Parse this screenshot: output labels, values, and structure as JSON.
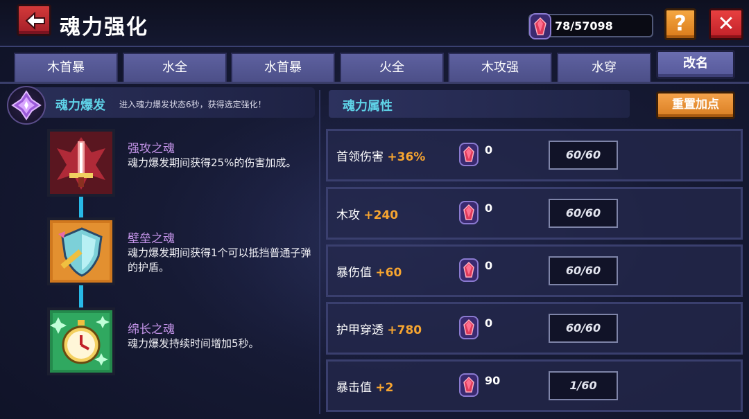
{
  "header": {
    "title": "魂力强化",
    "soul_currency": "78/57098",
    "help_label": "?",
    "close_label": "✕"
  },
  "tabs": [
    {
      "label": "木首暴"
    },
    {
      "label": "水全"
    },
    {
      "label": "水首暴"
    },
    {
      "label": "火全"
    },
    {
      "label": "木攻强"
    },
    {
      "label": "水穿"
    }
  ],
  "rename_label": "改名",
  "burst": {
    "title": "魂力爆发",
    "desc": "进入魂力爆发状态6秒，获得选定强化！"
  },
  "souls": [
    {
      "title": "强攻之魂",
      "desc": "魂力爆发期间获得25%的伤害加成。"
    },
    {
      "title": "壁垒之魂",
      "desc": "魂力爆发期间获得1个可以抵挡普通子弹的护盾。"
    },
    {
      "title": "绵长之魂",
      "desc": "魂力爆发持续时间增加5秒。"
    }
  ],
  "attributes_title": "魂力属性",
  "reset_label": "重置加点",
  "attributes": [
    {
      "name": "首领伤害",
      "bonus": "+36%",
      "cost": "0",
      "level": "60/60"
    },
    {
      "name": "木攻",
      "bonus": "+240",
      "cost": "0",
      "level": "60/60"
    },
    {
      "name": "暴伤值",
      "bonus": "+60",
      "cost": "0",
      "level": "60/60"
    },
    {
      "name": "护甲穿透",
      "bonus": "+780",
      "cost": "0",
      "level": "60/60"
    },
    {
      "name": "暴击值",
      "bonus": "+2",
      "cost": "90",
      "level": "1/60"
    }
  ],
  "icons": [
    "back-arrow-icon",
    "soul-gem-icon",
    "help-icon",
    "close-icon",
    "burst-crystal-icon",
    "sword-icon",
    "shield-icon",
    "stopwatch-icon"
  ],
  "colors": {
    "accent_cyan": "#5fd3e8",
    "bonus_orange": "#f7a530",
    "soul_title_purple": "#c595ea",
    "tab_purple": "#5e61a0",
    "close_red": "#e84040",
    "help_orange": "#f5a742"
  }
}
